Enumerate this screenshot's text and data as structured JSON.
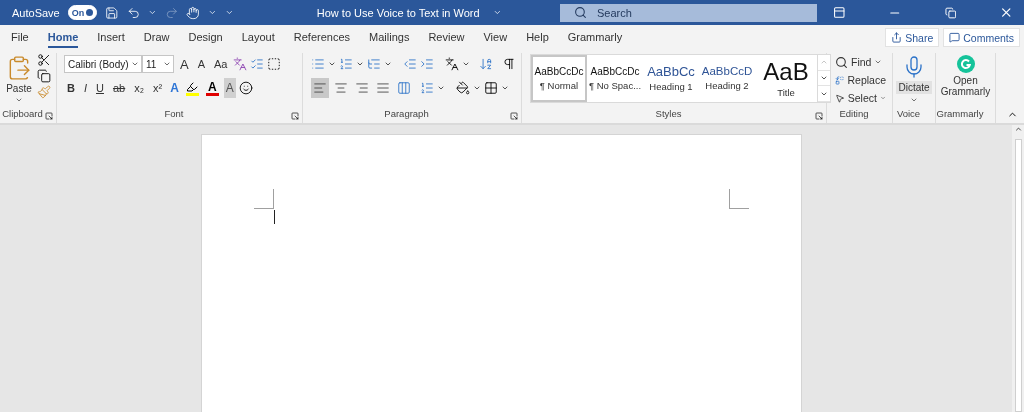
{
  "title_bar": {
    "autosave_label": "AutoSave",
    "autosave_toggle": {
      "label": "On",
      "on": true
    },
    "document_title": "How to Use Voice to Text in Word",
    "search": {
      "placeholder": "Search"
    }
  },
  "tabs": [
    {
      "label": "File",
      "selected": false
    },
    {
      "label": "Home",
      "selected": true
    },
    {
      "label": "Insert",
      "selected": false
    },
    {
      "label": "Draw",
      "selected": false
    },
    {
      "label": "Design",
      "selected": false
    },
    {
      "label": "Layout",
      "selected": false
    },
    {
      "label": "References",
      "selected": false
    },
    {
      "label": "Mailings",
      "selected": false
    },
    {
      "label": "Review",
      "selected": false
    },
    {
      "label": "View",
      "selected": false
    },
    {
      "label": "Help",
      "selected": false
    },
    {
      "label": "Grammarly",
      "selected": false
    }
  ],
  "share_button": "Share",
  "comments_button": "Comments",
  "clipboard": {
    "paste_label": "Paste",
    "group_label": "Clipboard"
  },
  "font": {
    "font_name": "Calibri (Body)",
    "font_size": "11",
    "grow": "A",
    "shrink": "A",
    "change_case": "Aa",
    "format_buttons": [
      "B",
      "I",
      "U",
      "ab",
      "x₂",
      "x²"
    ],
    "color_buttons": [
      {
        "kind": "effects",
        "label": "A",
        "color": "#2e75d6"
      },
      {
        "kind": "highlight",
        "color": "#ffff00"
      },
      {
        "kind": "font_color",
        "label": "A",
        "color": "#e00000"
      },
      {
        "kind": "shading",
        "label": "A"
      }
    ],
    "group_label": "Font"
  },
  "paragraph": {
    "alignments": [
      {
        "kind": "left",
        "selected": true
      },
      {
        "kind": "center",
        "selected": false
      },
      {
        "kind": "right",
        "selected": false
      },
      {
        "kind": "justify",
        "selected": false
      },
      {
        "kind": "distributed",
        "selected": false
      }
    ],
    "group_label": "Paragraph"
  },
  "styles": {
    "items": [
      {
        "sample": "AaBbCcDc",
        "label": "¶ Normal",
        "kind": "normal",
        "selected": true
      },
      {
        "sample": "AaBbCcDc",
        "label": "¶ No Spac...",
        "kind": "normal",
        "selected": false
      },
      {
        "sample": "AaBbCc",
        "label": "Heading 1",
        "kind": "heading1",
        "selected": false
      },
      {
        "sample": "AaBbCcD",
        "label": "Heading 2",
        "kind": "heading2",
        "selected": false
      },
      {
        "sample": "AaB",
        "label": "Title",
        "kind": "title",
        "selected": false
      }
    ],
    "group_label": "Styles"
  },
  "editing": {
    "find": "Find",
    "replace": "Replace",
    "select": "Select",
    "group_label": "Editing"
  },
  "voice": {
    "dictate": "Dictate",
    "group_label": "Voice"
  },
  "grammarly": {
    "open_label": "Open Grammarly",
    "group_label": "Grammarly"
  }
}
